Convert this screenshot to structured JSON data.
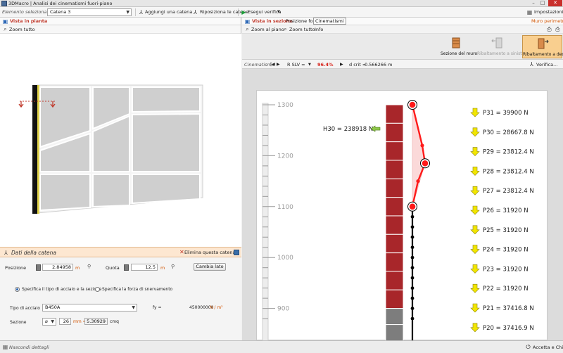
{
  "window": {
    "title": "3DMacro | Analisi dei cinematismi fuori-piano",
    "min": "–",
    "max": "□",
    "close": "✕"
  },
  "toolbar": {
    "element_label": "Elemento selezionato",
    "element_value": "Catena 3",
    "add_chain": "Aggiungi una catena",
    "reposition": "Riposiziona le catene",
    "run_check": "Esegui verifica",
    "settings": "Impostazioni..."
  },
  "left": {
    "tab": "Vista in pianta",
    "zoom_all": "Zoom tutto"
  },
  "chain": {
    "title": "Dati della catena",
    "delete": "Elimina questa catena",
    "position_label": "Posizione",
    "position_value": "2.84958",
    "position_unit": "m",
    "height_label": "Quota",
    "height_value": "12.5",
    "height_unit": "m",
    "change_side": "Cambia lato",
    "radio_type": "Specifica il tipo di acciaio e la sezione",
    "radio_force": "Specifica la forza di snervamento",
    "steel_label": "Tipo di acciaio",
    "steel_value": "B450A",
    "fy_label": "fy =",
    "fy_value": "450000000",
    "fy_unit": "N / m²",
    "section_label": "Sezione",
    "diameter_value": "26",
    "diameter_unit": "mm =",
    "area_value": "5.30929",
    "area_unit": "cmq"
  },
  "right": {
    "tab_section": "Vista in sezione",
    "tab_forces": "Posizione forze",
    "tab_cinematismi": "Cinematismi",
    "wall_name": "Muro perimetrale",
    "zoom_plane": "Zoom al piano",
    "zoom_all": "Zoom tutto",
    "info": "Info",
    "ribbon": [
      {
        "label": "Sezione del muro",
        "state": "normal"
      },
      {
        "label": "Ribaltamento a sinistra",
        "state": "disabled"
      },
      {
        "label": "Ribaltamento a destra",
        "state": "active"
      }
    ],
    "cinematismo_label": "Cinematismo",
    "slv_label": "R SLV =",
    "slv_value": "96.4%",
    "dcrit_label": "d crit =",
    "dcrit_value": "0.566266 m",
    "verify_label": "Verifica..."
  },
  "status": {
    "hide_details": "Nascondi dettagli",
    "accept_close": "Accetta e Chiudi"
  },
  "colors": {
    "brick": "#a8262a",
    "masonry_grey": "#7d7d7d",
    "mechanism": "#ff1a1a",
    "force_arrow": "#f2e600",
    "active_orange": "#f9cf8f"
  },
  "chart_data": {
    "type": "diagram",
    "ylim": [
      870,
      1310
    ],
    "ticks": [
      900,
      1000,
      1100,
      1200,
      1300
    ],
    "horizontal_force": "H30 = 238918 N",
    "loads": [
      "P31 = 39900 N",
      "P30 = 28667.8 N",
      "P29 = 23812.4 N",
      "P28 = 23812.4 N",
      "P27 = 23812.4 N",
      "P26 = 31920 N",
      "P25 = 31920 N",
      "P24 = 31920 N",
      "P23 = 31920 N",
      "P22 = 31920 N",
      "P21 = 37416.8 N",
      "P20 = 37416.9 N"
    ]
  }
}
